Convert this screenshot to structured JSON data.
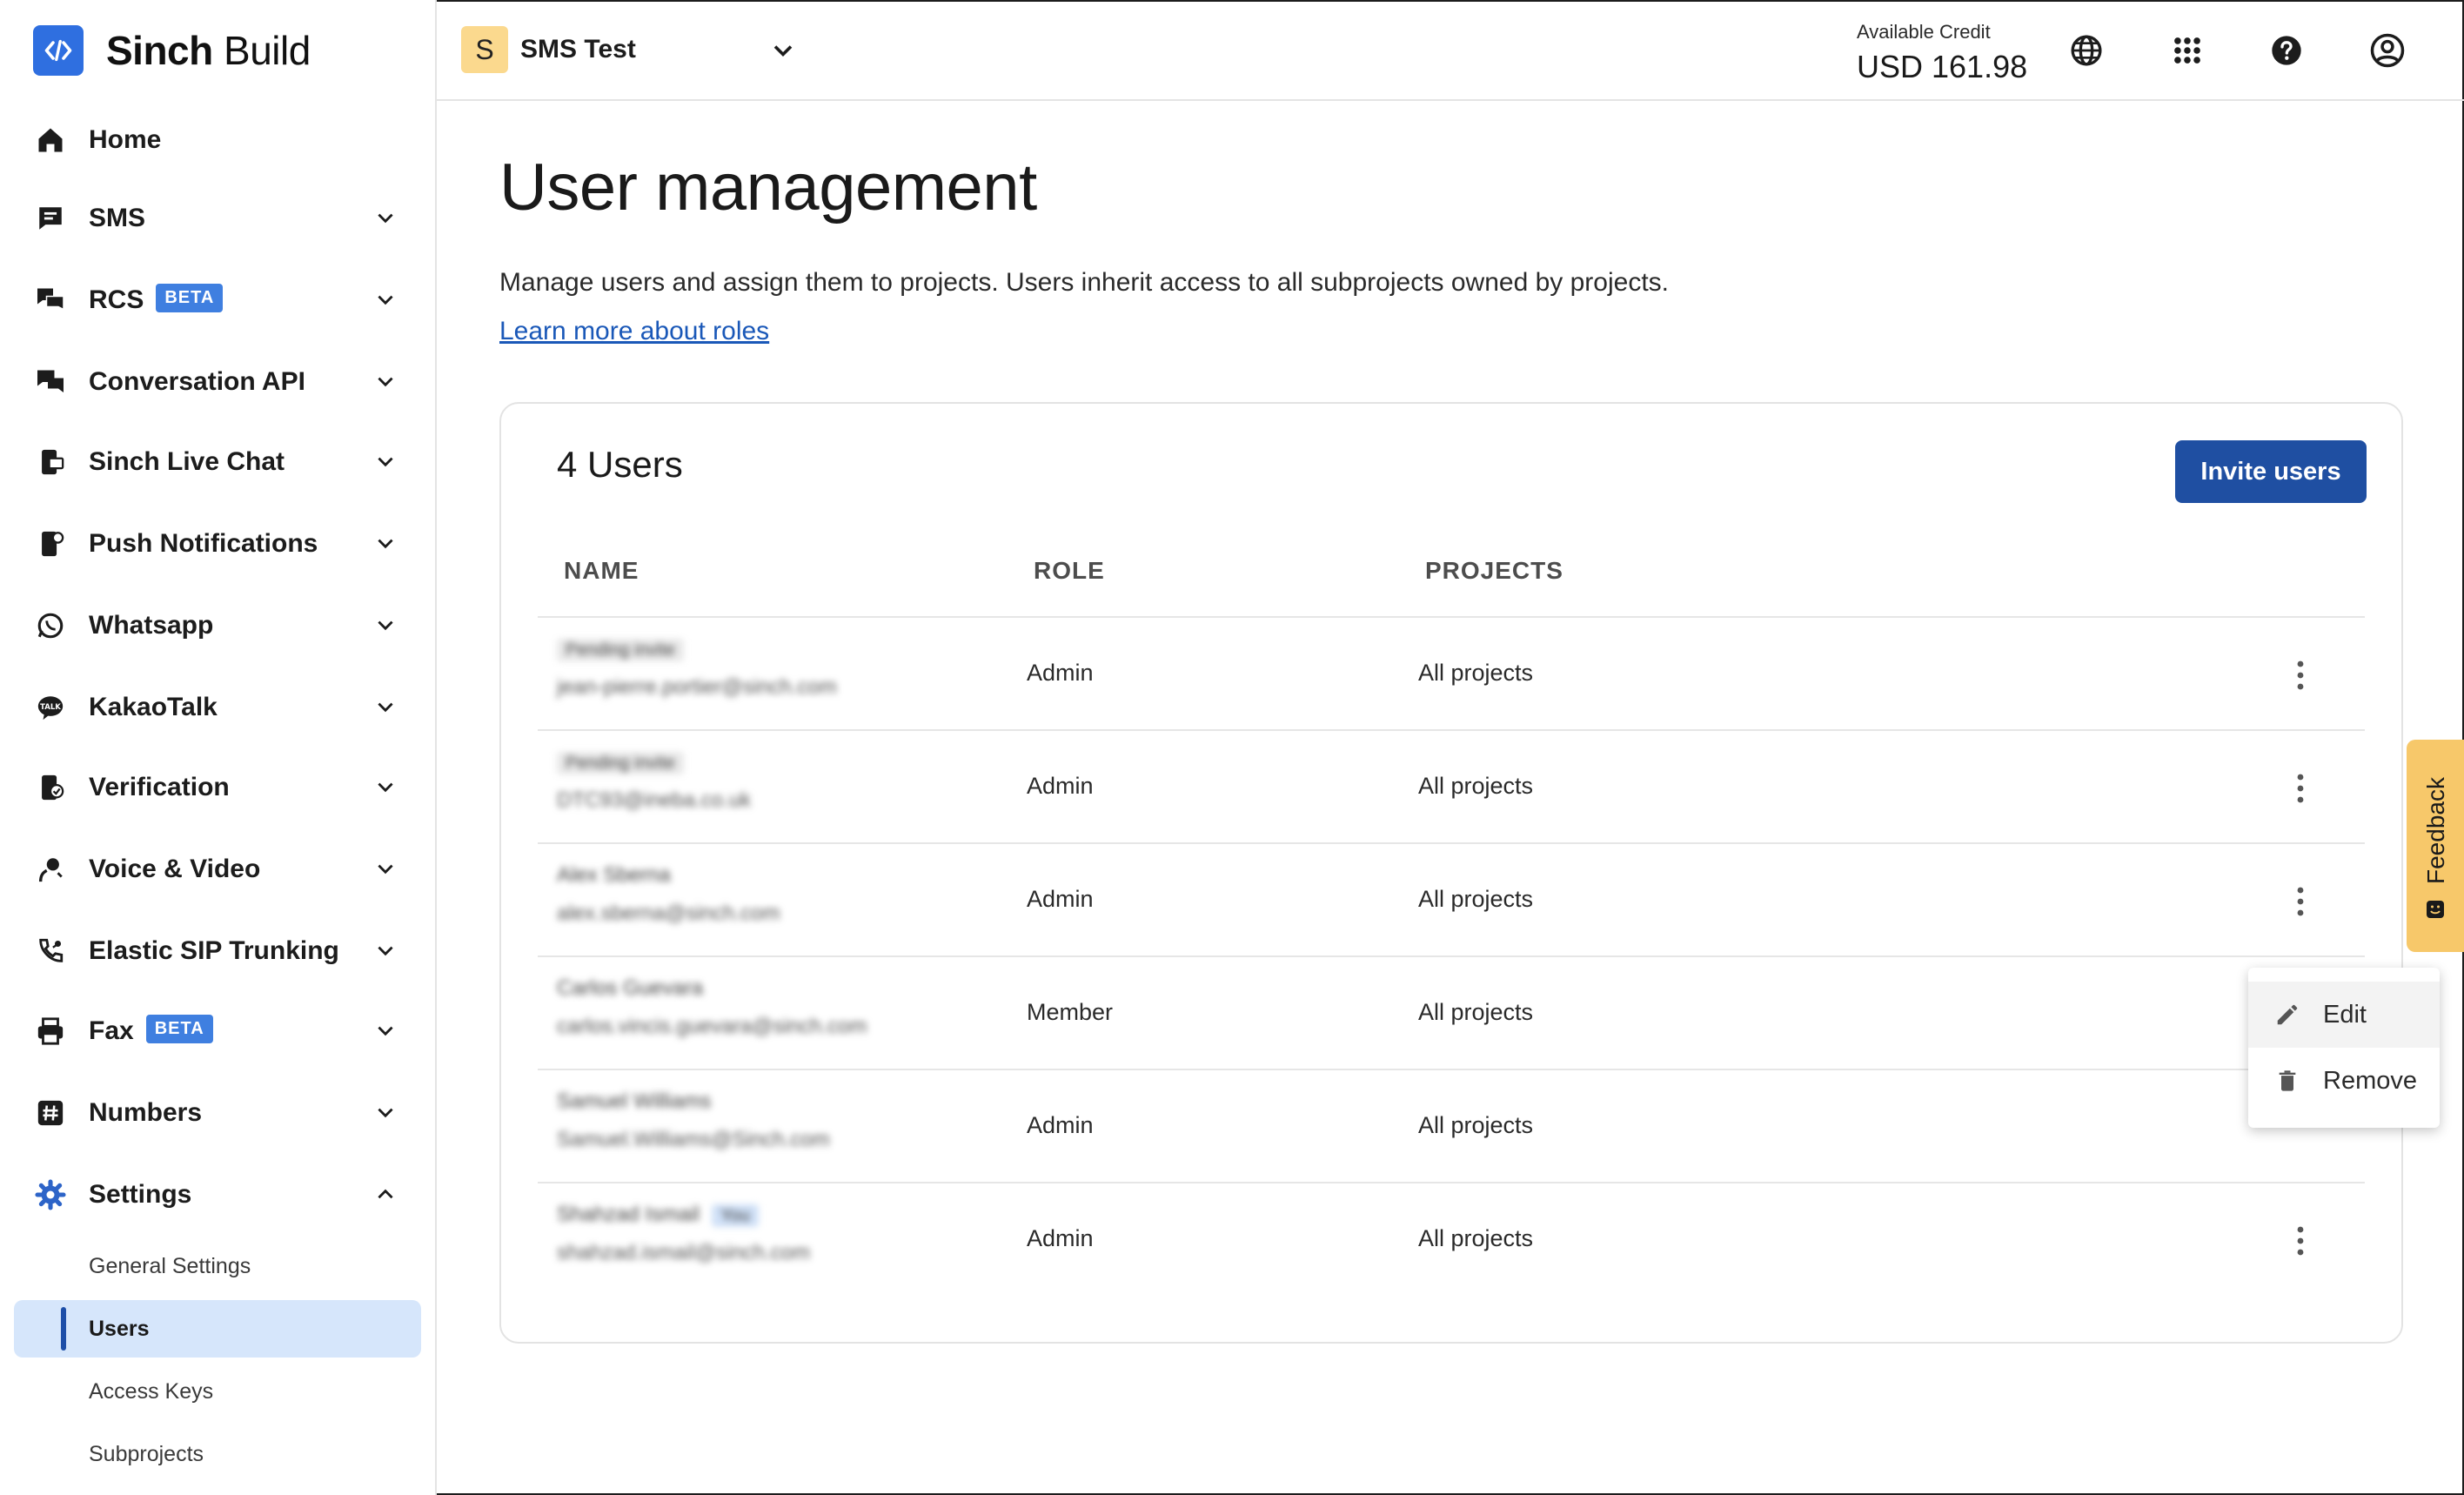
{
  "brand": {
    "name_bold": "Sinch",
    "name_light": "Build",
    "logo_icon": "code-brackets-icon",
    "logo_color": "#2f6fe0"
  },
  "sidebar": {
    "items": [
      {
        "label": "Home",
        "icon": "home-icon"
      },
      {
        "label": "SMS",
        "icon": "sms-icon"
      },
      {
        "label": "RCS",
        "icon": "rcs-icon",
        "badge": "BETA"
      },
      {
        "label": "Conversation API",
        "icon": "conversation-icon"
      },
      {
        "label": "Sinch Live Chat",
        "icon": "live-chat-icon"
      },
      {
        "label": "Push Notifications",
        "icon": "push-notification-icon"
      },
      {
        "label": "Whatsapp",
        "icon": "whatsapp-icon"
      },
      {
        "label": "KakaoTalk",
        "icon": "kakaotalk-icon"
      },
      {
        "label": "Verification",
        "icon": "verification-icon"
      },
      {
        "label": "Voice & Video",
        "icon": "voice-icon"
      },
      {
        "label": "Elastic SIP Trunking",
        "icon": "sip-icon"
      },
      {
        "label": "Fax",
        "icon": "fax-icon",
        "badge": "BETA"
      },
      {
        "label": "Numbers",
        "icon": "hash-icon"
      },
      {
        "label": "Settings",
        "icon": "gear-icon"
      }
    ],
    "settings_sub": [
      {
        "label": "General Settings"
      },
      {
        "label": "Users",
        "active": true
      },
      {
        "label": "Access Keys"
      },
      {
        "label": "Subprojects"
      }
    ]
  },
  "topbar": {
    "project_initial": "S",
    "project_name": "SMS Test",
    "credit_label": "Available Credit",
    "credit_value": "USD 161.98",
    "icons": [
      "globe-icon",
      "apps-grid-icon",
      "help-icon",
      "account-icon"
    ]
  },
  "main": {
    "title": "User management",
    "description": "Manage users and assign them to projects. Users inherit access to all subprojects owned by projects.",
    "learn_link": "Learn more about roles",
    "users_count_label": "4 Users",
    "invite_button": "Invite users",
    "columns": [
      "NAME",
      "ROLE",
      "PROJECTS"
    ],
    "rows": [
      {
        "name": "Pending invite",
        "email": "jean-pierre.portier@sinch.com",
        "role": "Admin",
        "projects": "All projects",
        "pending": true
      },
      {
        "name": "Pending invite",
        "email": "DTC93@ineba.co.uk",
        "role": "Admin",
        "projects": "All projects",
        "pending": true
      },
      {
        "name": "Alex Sberna",
        "email": "alex.sberna@sinch.com",
        "role": "Admin",
        "projects": "All projects"
      },
      {
        "name": "Carlos Guevara",
        "email": "carlos.vincis.guevara@sinch.com",
        "role": "Member",
        "projects": "All projects"
      },
      {
        "name": "Samuel Williams",
        "email": "Samuel.Williams@Sinch.com",
        "role": "Admin",
        "projects": "All projects"
      },
      {
        "name": "Shahzad Ismail",
        "email": "shahzad.ismail@sinch.com",
        "role": "Admin",
        "projects": "All projects",
        "you_tag": "You"
      }
    ]
  },
  "row_menu": {
    "items": [
      {
        "label": "Edit",
        "icon": "pencil-icon"
      },
      {
        "label": "Remove",
        "icon": "trash-icon"
      }
    ]
  },
  "feedback": {
    "label": "Feedback",
    "color": "#f7c86a"
  },
  "colors": {
    "primary": "#1f4fa2",
    "link": "#1a58b8",
    "active_bg": "#d6e6fb"
  }
}
